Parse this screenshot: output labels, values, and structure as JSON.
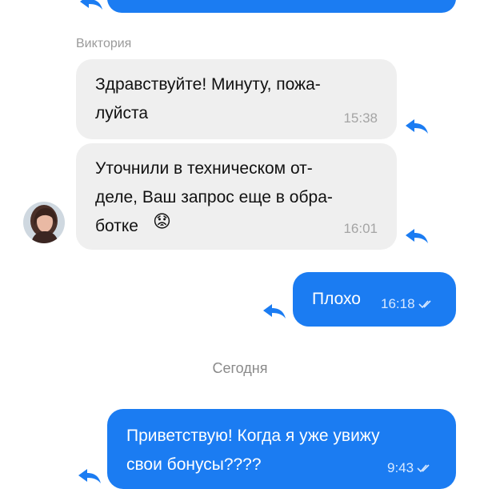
{
  "messages": [
    {
      "direction": "incoming",
      "sender": "Виктория",
      "text": "Здравствуйте! Минуту, пожа-\nлуйста",
      "time": "15:38"
    },
    {
      "direction": "incoming",
      "text": "Уточнили в техническом от-\nделе, Ваш запрос еще в обра-\nботке",
      "emoji": "😟",
      "time": "16:01"
    },
    {
      "direction": "outgoing",
      "text": "Плохо",
      "time": "16:18",
      "status": "read"
    },
    {
      "direction": "outgoing",
      "text": "Приветствую! Когда я уже увижу\nсвои бонусы????",
      "time": "9:43",
      "status": "read"
    }
  ],
  "day_separator": "Сегодня",
  "colors": {
    "outgoing_bubble": "#1b7cf2",
    "incoming_bubble": "#efefef",
    "reply_icon": "#1b7cf2"
  },
  "icons": {
    "reply": "reply-arrow-icon",
    "read": "double-check-icon"
  }
}
